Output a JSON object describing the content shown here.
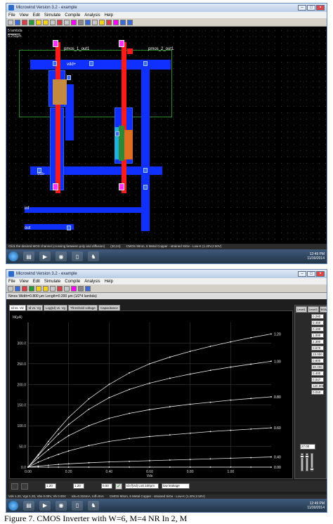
{
  "window1": {
    "title": "Microwind Version 3.2 - example",
    "menu": [
      "File",
      "View",
      "Edit",
      "Simulate",
      "Compile",
      "Analysis",
      "Help"
    ],
    "ruler": {
      "top": "5 lambda",
      "bottom": "0.250μm"
    },
    "labels": {
      "pmos_1_out1": "pmos_1_out1",
      "pmos_2_out1": "pmos_2_out1",
      "vdd": "vdd+",
      "vss": "vss-",
      "inf": "inf",
      "out": "out"
    },
    "status": {
      "hint": "Click the desired MOS channel (crossing between poly and diffusion)",
      "coord": "(20,24)",
      "tech": "CMOS 90nm, 6 Metal Copper - strained SiGe - Low-K (1.20V,2.50V)"
    },
    "tray": {
      "time": "12:49 PM",
      "date": "11/30/2014"
    }
  },
  "window2": {
    "title": "Microwind Version 3.2 - example",
    "menu": [
      "File",
      "View",
      "Edit",
      "Simulate",
      "Compile",
      "Analysis",
      "Help"
    ],
    "subtitle": "Nmos Width=0.800 μm Length=0.200 μm (1/2*4 lambda)",
    "tabs": [
      "Id vs. Vd",
      "Id vs. Vg",
      "Log(Id) vs. Vg",
      "Threshold voltage",
      "Capacitance"
    ],
    "level_tabs": [
      "Level1",
      "Level3",
      "BSIM4"
    ],
    "params": [
      "0.280",
      "0.450",
      "0.100",
      "1.000",
      "2.300",
      "0.570",
      "23.000",
      "0.800",
      "80.000",
      "0.400",
      "0.047",
      "120.000",
      "0.010"
    ],
    "zoom_value": "27.00",
    "bottom": {
      "vd": "1.20",
      "vg": "1.20",
      "vs": "0.00",
      "mode": "Id=f(Vd) Lo0.100μm",
      "leak": "low leakage"
    },
    "status": {
      "left": "Vds 1.20, Vgs 1.20, Vbs 0.00V, Vb 0.00V",
      "mid": "Ids=0.324mA, Ioff=0nA",
      "tech": "CMOS 90nm, 6 Metal Copper - strained SiGe - Low-K (1.20V,2.50V)"
    },
    "tray": {
      "time": "12:49 PM",
      "date": "11/30/2014"
    }
  },
  "chart_data": {
    "type": "line",
    "ylabel": "Id(μA)",
    "xlabel": "Vds",
    "xlim": [
      0,
      1.2
    ],
    "ylim": [
      0,
      350
    ],
    "xticks": [
      "0.00",
      "0.20",
      "0.40",
      "0.60",
      "0.80",
      "1.00"
    ],
    "yticks": [
      "0.0",
      "50.0",
      "100.0",
      "150.0",
      "200.0",
      "250.0",
      "300.0"
    ],
    "x": [
      0,
      0.05,
      0.1,
      0.15,
      0.2,
      0.3,
      0.4,
      0.5,
      0.6,
      0.7,
      0.8,
      0.9,
      1.0,
      1.1,
      1.2
    ],
    "series": [
      {
        "name": "1.20",
        "values": [
          0,
          30,
          62,
          92,
          120,
          165,
          200,
          228,
          250,
          266,
          280,
          292,
          303,
          313,
          322
        ]
      },
      {
        "name": "1.00",
        "values": [
          0,
          28,
          55,
          80,
          103,
          140,
          168,
          188,
          203,
          215,
          225,
          234,
          242,
          249,
          256
        ]
      },
      {
        "name": "0.80",
        "values": [
          0,
          22,
          42,
          60,
          76,
          100,
          118,
          130,
          139,
          146,
          152,
          157,
          162,
          166,
          170
        ]
      },
      {
        "name": "0.60",
        "values": [
          0,
          12,
          22,
          31,
          39,
          52,
          62,
          69,
          74,
          78,
          82,
          86,
          89,
          92,
          95
        ]
      },
      {
        "name": "0.40",
        "values": [
          0,
          2.5,
          4.5,
          6.5,
          8,
          10.5,
          12.5,
          14,
          15.5,
          17,
          18.5,
          20,
          21.5,
          23,
          24.5
        ]
      },
      {
        "name": "0.00",
        "values": [
          0,
          0,
          0,
          0,
          0,
          0,
          0,
          0,
          0,
          0,
          0,
          0,
          0,
          0,
          0
        ]
      }
    ]
  },
  "caption": {
    "text": "Figure 7. CMOS Inverter with W=6, M=4 NR In 2, M"
  }
}
